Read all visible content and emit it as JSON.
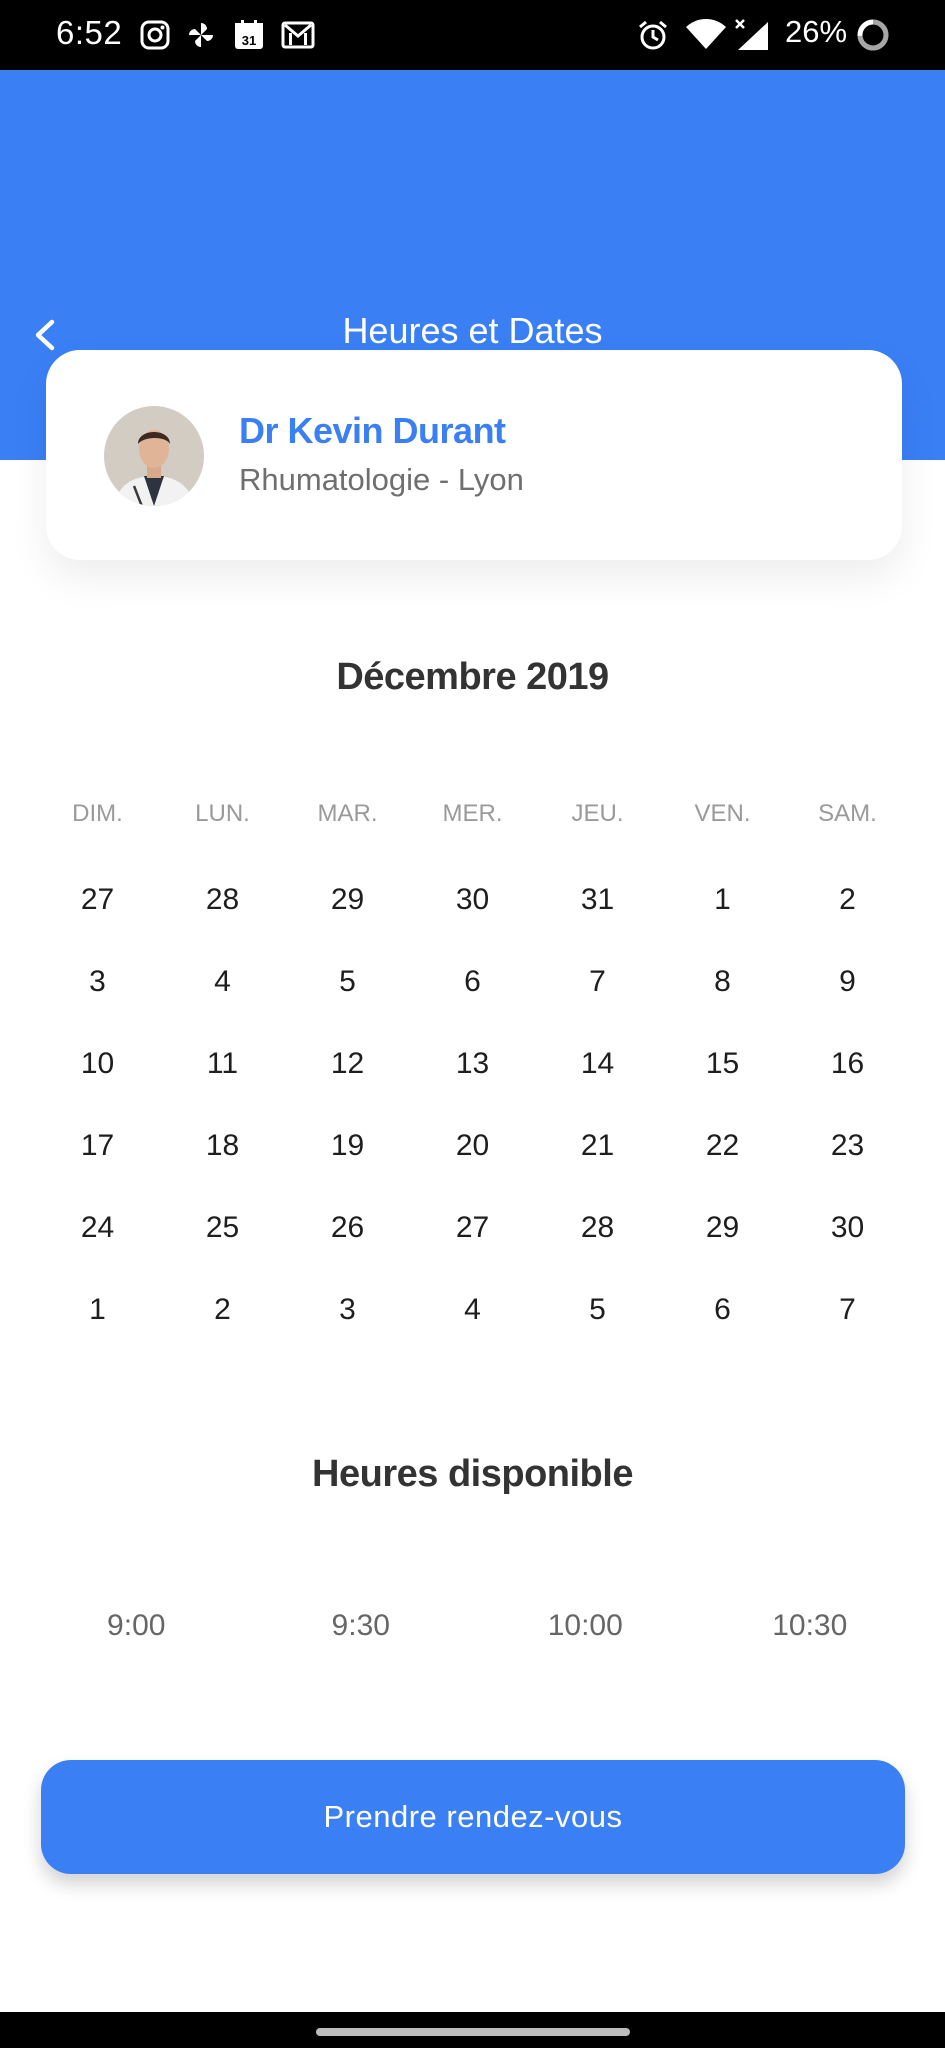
{
  "status_bar": {
    "time": "6:52",
    "calendar_day": "31",
    "battery": "26%"
  },
  "header": {
    "title": "Heures et Dates",
    "back_icon": "chevron-left-icon",
    "color": "#3b7ff5"
  },
  "doctor": {
    "name": "Dr Kevin Durant",
    "specialty": "Rhumatologie - Lyon"
  },
  "calendar": {
    "month": "Décembre 2019",
    "weekdays": [
      "DIM.",
      "LUN.",
      "MAR.",
      "MER.",
      "JEU.",
      "VEN.",
      "SAM."
    ],
    "weeks": [
      [
        "27",
        "28",
        "29",
        "30",
        "31",
        "1",
        "2"
      ],
      [
        "3",
        "4",
        "5",
        "6",
        "7",
        "8",
        "9"
      ],
      [
        "10",
        "11",
        "12",
        "13",
        "14",
        "15",
        "16"
      ],
      [
        "17",
        "18",
        "19",
        "20",
        "21",
        "22",
        "23"
      ],
      [
        "24",
        "25",
        "26",
        "27",
        "28",
        "29",
        "30"
      ],
      [
        "1",
        "2",
        "3",
        "4",
        "5",
        "6",
        "7"
      ]
    ]
  },
  "hours": {
    "title": "Heures disponible",
    "slots": [
      "9:00",
      "9:30",
      "10:00",
      "10:30"
    ]
  },
  "cta": {
    "label": "Prendre rendez-vous"
  }
}
